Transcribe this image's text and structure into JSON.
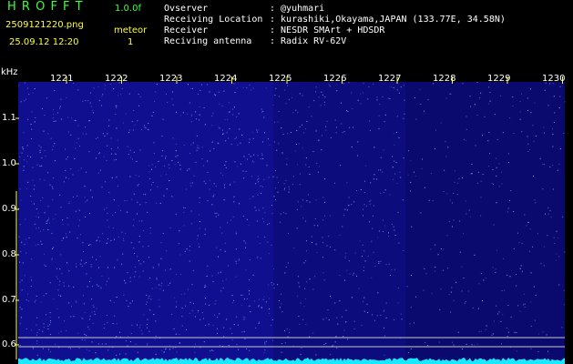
{
  "header": {
    "app_name": "H R O F F T",
    "version": "1.0.0f",
    "filename": "2509121220.png",
    "datetime": "25.09.12 12:20",
    "meteor_label": "meteor",
    "meteor_count": "1",
    "info_labels": [
      "Ovserver",
      "Receiving Location",
      "Receiver",
      "Reciving antenna"
    ],
    "info_values": [
      ": @yuhmari",
      ": kurashiki,Okayama,JAPAN (133.77E, 34.58N)",
      ": NESDR SMArt + HDSDR",
      ": Radix RV-62V"
    ]
  },
  "axes": {
    "y_unit": "kHz",
    "y_ticks": [
      "1.1",
      "1.0",
      "0.9",
      "0.8",
      "0.7",
      "0.6"
    ],
    "x_ticks": [
      "1221",
      "1222",
      "1223",
      "1224",
      "1225",
      "1226",
      "1227",
      "1228",
      "1229",
      "1230"
    ]
  },
  "colors": {
    "background": "#000000",
    "spectrogram_dark": "#0a0a6e",
    "spectrogram_mid": "#1a1ad0",
    "speckle": "#a0c8ff",
    "tick": "#ffff3c",
    "title_green": "#3cff3c",
    "baseline_cyan": "#19e8ff"
  }
}
